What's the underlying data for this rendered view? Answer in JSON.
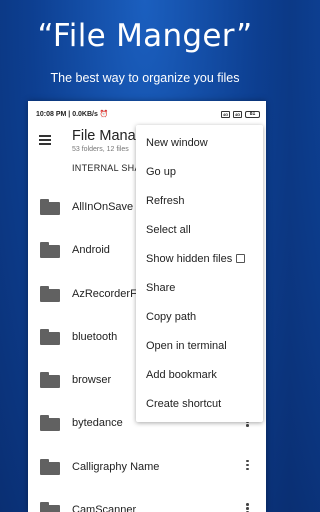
{
  "promo": {
    "title": "“File Manger”",
    "subtitle": "The best way to organize you files"
  },
  "status_bar": {
    "left": "10:08 PM | 0.0KB/s ⏰",
    "signal1": "4G",
    "signal2": "4G",
    "battery": "81"
  },
  "app_bar": {
    "title": "File Manag",
    "subtitle": "53 folders, 12 files",
    "path": "INTERNAL SHA"
  },
  "files": [
    {
      "name": "AllInOnSave",
      "has_menu": false
    },
    {
      "name": "Android",
      "has_menu": false
    },
    {
      "name": "AzRecorderFr",
      "has_menu": false
    },
    {
      "name": "bluetooth",
      "has_menu": false
    },
    {
      "name": "browser",
      "has_menu": false
    },
    {
      "name": "bytedance",
      "has_menu": true
    },
    {
      "name": "Calligraphy Name",
      "has_menu": true
    },
    {
      "name": "CamScanner",
      "has_menu": true
    }
  ],
  "context_menu": {
    "items": [
      "New window",
      "Go up",
      "Refresh",
      "Select all",
      "Show hidden files",
      "Share",
      "Copy path",
      "Open in terminal",
      "Add bookmark",
      "Create shortcut"
    ],
    "show_hidden_checked": false
  },
  "icons": {
    "menu": "hamburger-menu-icon",
    "folder": "folder-icon",
    "overflow": "kebab-menu-icon",
    "checkbox": "checkbox-icon"
  },
  "colors": {
    "background": "#0d3f91",
    "folder": "#616161",
    "text": "#222222"
  }
}
